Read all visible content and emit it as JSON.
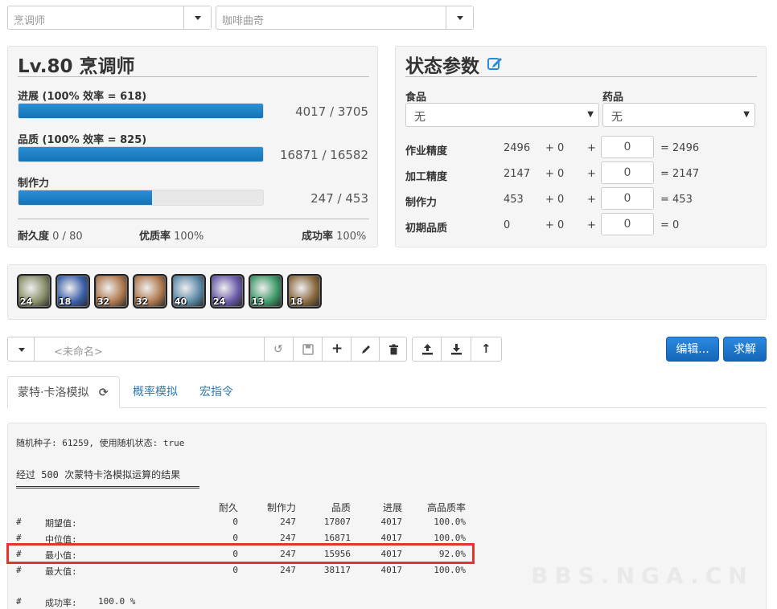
{
  "selects": {
    "job": {
      "value": "烹调师"
    },
    "recipe": {
      "value": "咖啡曲奇"
    }
  },
  "crafter": {
    "title": "Lv.80 烹调师",
    "progress": {
      "label": "进展 (100% 效率 = 618)",
      "value": "4017 / 3705",
      "fill": 1.0
    },
    "quality": {
      "label": "品质  (100% 效率 = 825)",
      "value": "16871 / 16582",
      "fill": 1.0
    },
    "cp": {
      "label": "制作力",
      "value": "247 / 453",
      "fill": 0.545
    },
    "footer": {
      "durability_label": "耐久度",
      "durability_value": "0 / 80",
      "hq_label": "优质率",
      "hq_value": "100%",
      "success_label": "成功率",
      "success_value": "100%"
    }
  },
  "status": {
    "title": "状态参数",
    "food_label": "食品",
    "food_value": "无",
    "medicine_label": "药品",
    "medicine_value": "无",
    "rows": [
      {
        "label": "作业精度",
        "base": "2496",
        "bonus": "+ 0",
        "plus": "+",
        "input": "0",
        "total": "= 2496"
      },
      {
        "label": "加工精度",
        "base": "2147",
        "bonus": "+ 0",
        "plus": "+",
        "input": "0",
        "total": "= 2147"
      },
      {
        "label": "制作力",
        "base": "453",
        "bonus": "+ 0",
        "plus": "+",
        "input": "0",
        "total": "= 453"
      },
      {
        "label": "初期品质",
        "base": "0",
        "bonus": "+ 0",
        "plus": "+",
        "input": "0",
        "total": "= 0"
      }
    ]
  },
  "skills": [
    {
      "count": "24",
      "color": "#8a8f6a"
    },
    {
      "count": "18",
      "color": "#3b5fa8"
    },
    {
      "count": "32",
      "color": "#b07a50"
    },
    {
      "count": "32",
      "color": "#b07a50"
    },
    {
      "count": "40",
      "color": "#5c8aa8"
    },
    {
      "count": "24",
      "color": "#6a5aa8"
    },
    {
      "count": "13",
      "color": "#3f9a6a"
    },
    {
      "count": "18",
      "color": "#8a6a40"
    }
  ],
  "toolbar": {
    "name_placeholder": "<未命名>",
    "edit_label": "编辑...",
    "solve_label": "求解"
  },
  "tabs": [
    {
      "label": "蒙特·卡洛模拟"
    },
    {
      "label": "概率模拟"
    },
    {
      "label": "宏指令"
    }
  ],
  "output": {
    "seed_line": "随机种子: 61259, 使用随机状态: true",
    "summary_line": "经过 500 次蒙特卡洛模拟运算的结果",
    "underline": "===============================",
    "headers": [
      "耐久",
      "制作力",
      "品质",
      "进展",
      "高品质率"
    ],
    "rows": [
      {
        "mark": "#",
        "label": "期望值:",
        "cells": [
          "0",
          "247",
          "17807",
          "4017",
          "100.0%"
        ]
      },
      {
        "mark": "#",
        "label": "中位值:",
        "cells": [
          "0",
          "247",
          "16871",
          "4017",
          "100.0%"
        ]
      },
      {
        "mark": "#",
        "label": "最小值:",
        "cells": [
          "0",
          "247",
          "15956",
          "4017",
          "92.0%"
        ]
      },
      {
        "mark": "#",
        "label": "最大值:",
        "cells": [
          "0",
          "247",
          "38117",
          "4017",
          "100.0%"
        ]
      }
    ],
    "success_mark": "#",
    "success_label": "成功率:",
    "success_value": "100.0 %"
  },
  "watermark": "BBS.NGA.CN"
}
